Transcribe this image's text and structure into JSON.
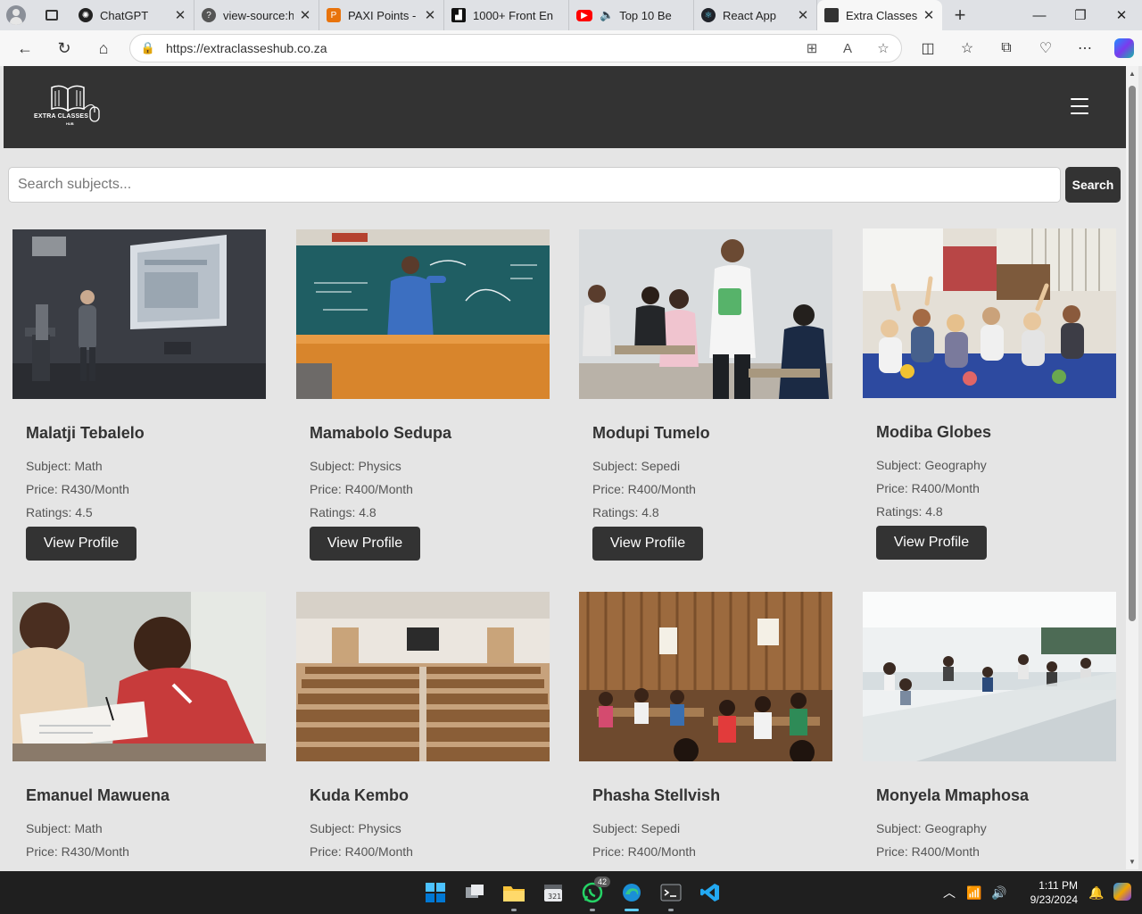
{
  "browser": {
    "tabs": [
      {
        "title": "ChatGPT",
        "favicon": "chatgpt-icon",
        "active": false
      },
      {
        "title": "view-source:htt",
        "favicon": "view-source-icon",
        "active": false
      },
      {
        "title": "PAXI Points - C",
        "favicon": "paxi-icon",
        "active": false
      },
      {
        "title": "1000+ Front En",
        "favicon": "frontend-icon",
        "active": false
      },
      {
        "title": "Top 10 Be",
        "favicon": "youtube-icon",
        "active": false,
        "audio": true
      },
      {
        "title": "React App",
        "favicon": "react-icon",
        "active": false
      },
      {
        "title": "Extra Classes H",
        "favicon": "page-icon",
        "active": true
      }
    ],
    "url": "https://extraclasseshub.co.za"
  },
  "site": {
    "logo_text": "EXTRA CLASSES",
    "logo_subtext": "HUB",
    "search": {
      "placeholder": "Search subjects...",
      "button": "Search"
    },
    "card_button": "View Profile",
    "tutors": [
      {
        "name": "Malatji Tebalelo",
        "subject": "Subject: Math",
        "price": "Price: R430/Month",
        "rating": "Ratings: 4.5",
        "photo": "lecture-projector"
      },
      {
        "name": "Mamabolo Sedupa",
        "subject": "Subject: Physics",
        "price": "Price: R400/Month",
        "rating": "Ratings: 4.8",
        "photo": "chalkboard-teacher"
      },
      {
        "name": "Modupi Tumelo",
        "subject": "Subject: Sepedi",
        "price": "Price: R400/Month",
        "rating": "Ratings: 4.8",
        "photo": "classroom-students"
      },
      {
        "name": "Modiba Globes",
        "subject": "Subject: Geography",
        "price": "Price: R400/Month",
        "rating": "Ratings: 4.8",
        "photo": "kids-on-carpet"
      },
      {
        "name": "Emanuel Mawuena",
        "subject": "Subject: Math",
        "price": "Price: R430/Month",
        "rating": "",
        "photo": "children-writing"
      },
      {
        "name": "Kuda Kembo",
        "subject": "Subject: Physics",
        "price": "Price: R400/Month",
        "rating": "",
        "photo": "empty-auditorium"
      },
      {
        "name": "Phasha Stellvish",
        "subject": "Subject: Sepedi",
        "price": "Price: R400/Month",
        "rating": "",
        "photo": "wooden-classroom"
      },
      {
        "name": "Monyela Mmaphosa",
        "subject": "Subject: Geography",
        "price": "Price: R400/Month",
        "rating": "",
        "photo": "bright-classroom"
      }
    ]
  },
  "taskbar": {
    "whatsapp_badge": "42",
    "time": "1:11 PM",
    "date": "9/23/2024"
  }
}
